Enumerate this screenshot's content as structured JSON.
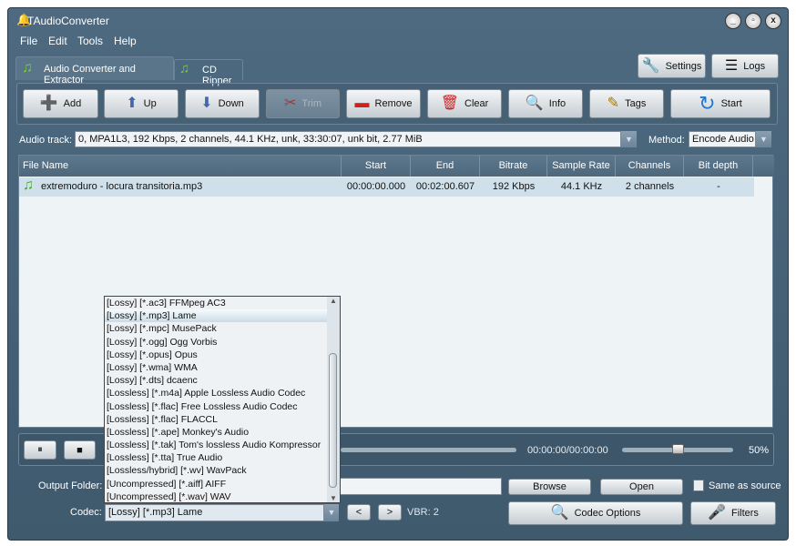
{
  "window": {
    "title": "TAudioConverter",
    "minimize": "_",
    "maximize": "▫",
    "close": "x"
  },
  "menu": [
    "File",
    "Edit",
    "Tools",
    "Help"
  ],
  "tabs": [
    {
      "label": "Audio Converter and Extractor",
      "active": true
    },
    {
      "label": "CD Ripper",
      "active": false
    }
  ],
  "top_buttons": {
    "settings": "Settings",
    "logs": "Logs"
  },
  "toolbar": [
    {
      "label": "Add",
      "icon": "➕",
      "name": "add"
    },
    {
      "label": "Up",
      "icon": "⬆",
      "name": "up"
    },
    {
      "label": "Down",
      "icon": "⬇",
      "name": "down"
    },
    {
      "label": "Trim",
      "icon": "✂",
      "name": "trim",
      "disabled": true
    },
    {
      "label": "Remove",
      "icon": "▬",
      "name": "remove"
    },
    {
      "label": "Clear",
      "icon": "🗑",
      "name": "clear"
    },
    {
      "label": "Info",
      "icon": "🔍",
      "name": "info"
    },
    {
      "label": "Tags",
      "icon": "✎",
      "name": "tags"
    },
    {
      "label": "Start",
      "icon": "↻",
      "name": "start"
    }
  ],
  "audio_track": {
    "label": "Audio track:",
    "value": "0, MPA1L3, 192 Kbps, 2 channels, 44.1 KHz, unk, 33:30:07, unk bit, 2.77 MiB"
  },
  "method": {
    "label": "Method:",
    "value": "Encode Audio"
  },
  "table": {
    "columns": [
      "File Name",
      "Start",
      "End",
      "Bitrate",
      "Sample Rate",
      "Channels",
      "Bit depth"
    ],
    "rows": [
      [
        "extremoduro - locura transitoria.mp3",
        "00:00:00.000",
        "00:02:00.607",
        "192 Kbps",
        "44.1 KHz",
        "2 channels",
        "-"
      ]
    ]
  },
  "player": {
    "time": "00:00:00/00:00:00",
    "volume_label": "50%",
    "volume": 0.5
  },
  "output": {
    "label": "Output Folder:",
    "value": "",
    "browse": "Browse",
    "open": "Open",
    "same_as_source": "Same as source",
    "same_checked": false
  },
  "codec": {
    "label": "Codec:",
    "value": "[Lossy] [*.mp3] Lame",
    "prev": "<",
    "next": ">",
    "vbr": "VBR: 2",
    "options": "Codec Options",
    "filters": "Filters",
    "list": [
      "[Lossy] [*.ac3] FFMpeg AC3",
      "[Lossy] [*.mp3] Lame",
      "[Lossy] [*.mpc] MusePack",
      "[Lossy] [*.ogg] Ogg Vorbis",
      "[Lossy] [*.opus] Opus",
      "[Lossy] [*.wma] WMA",
      "[Lossy] [*.dts] dcaenc",
      "[Lossless] [*.m4a] Apple Lossless Audio Codec",
      "[Lossless] [*.flac] Free Lossless Audio Codec",
      "[Lossless] [*.flac] FLACCL",
      "[Lossless] [*.ape] Monkey's Audio",
      "[Lossless] [*.tak] Tom's lossless Audio Kompressor",
      "[Lossless] [*.tta] True Audio",
      "[Lossless/hybrid] [*.wv] WavPack",
      "[Uncompressed] [*.aiff] AIFF",
      "[Uncompressed] [*.wav] WAV"
    ],
    "selected_index": 1
  }
}
